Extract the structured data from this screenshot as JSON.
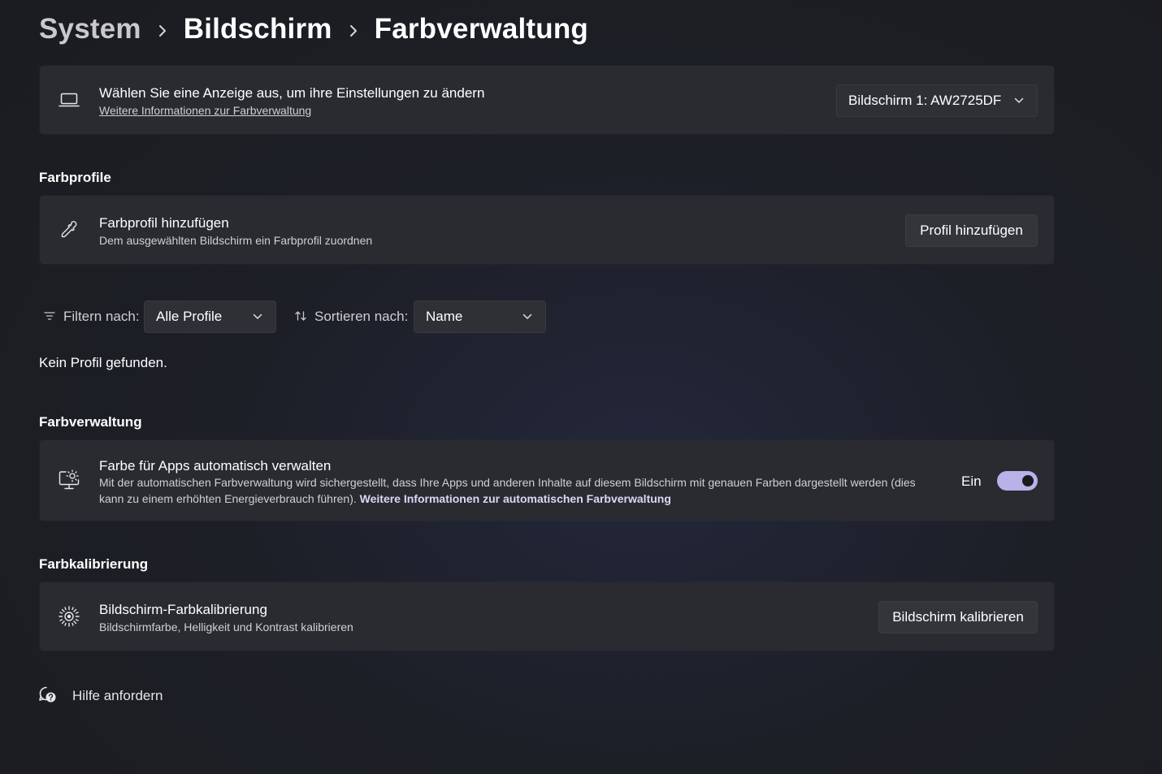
{
  "breadcrumb": {
    "items": [
      "System",
      "Bildschirm",
      "Farbverwaltung"
    ]
  },
  "display_card": {
    "title": "Wählen Sie eine Anzeige aus, um ihre Einstellungen zu ändern",
    "link": "Weitere Informationen zur Farbverwaltung",
    "selected_display": "Bildschirm 1: AW2725DF",
    "icon": "laptop-icon"
  },
  "profiles_section": {
    "heading": "Farbprofile",
    "add_card": {
      "title": "Farbprofil hinzufügen",
      "subtitle": "Dem ausgewählten Bildschirm ein Farbprofil zuordnen",
      "button": "Profil hinzufügen",
      "icon": "eyedropper-icon"
    },
    "filter": {
      "label": "Filtern nach:",
      "value": "Alle Profile",
      "icon": "filter-icon"
    },
    "sort": {
      "label": "Sortieren nach:",
      "value": "Name",
      "icon": "sort-icon"
    },
    "empty_text": "Kein Profil gefunden."
  },
  "management_section": {
    "heading": "Farbverwaltung",
    "card": {
      "title": "Farbe für Apps automatisch verwalten",
      "description": "Mit der automatischen Farbverwaltung wird sichergestellt, dass Ihre Apps und anderen Inhalte auf diesem Bildschirm mit genauen Farben dargestellt werden (dies kann zu einem erhöhten Energieverbrauch führen). ",
      "link": "Weitere Informationen zur automatischen Farbverwaltung",
      "toggle_label": "Ein",
      "toggle_on": true,
      "toggle_color": "#b7b2e8",
      "icon": "monitor-color-icon"
    }
  },
  "calibration_section": {
    "heading": "Farbkalibrierung",
    "card": {
      "title": "Bildschirm-Farbkalibrierung",
      "subtitle": "Bildschirmfarbe, Helligkeit und Kontrast kalibrieren",
      "button": "Bildschirm kalibrieren",
      "icon": "brightness-icon"
    }
  },
  "help": {
    "label": "Hilfe anfordern",
    "icon": "help-chat-icon"
  }
}
